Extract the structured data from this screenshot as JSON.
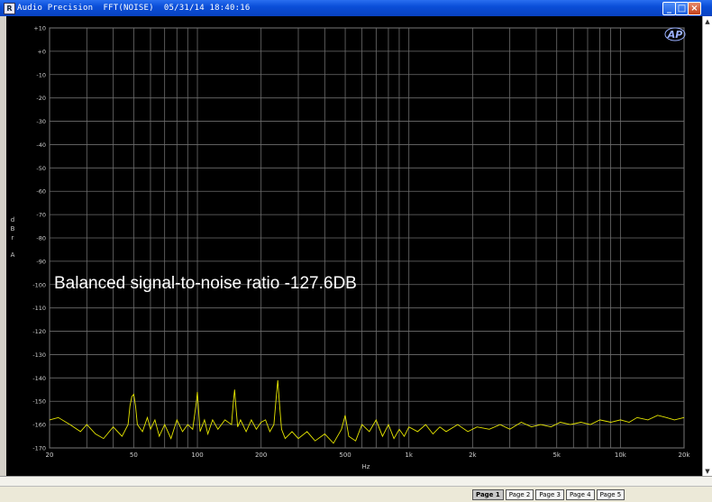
{
  "window": {
    "title": "Audio Precision  FFT(NOISE)  05/31/14 18:40:16",
    "buttons": {
      "minimize": "_",
      "maximize": "□",
      "close": "×"
    }
  },
  "graph": {
    "logo": "AP",
    "annotation": "Balanced signal-to-noise ratio -127.6DB",
    "y_unit_label": [
      "d",
      "B",
      "r",
      "A"
    ]
  },
  "chart_data": {
    "type": "line",
    "xscale": "log",
    "xlabel": "Hz",
    "ylabel": "dBr A",
    "xlim": [
      20,
      20000
    ],
    "ylim": [
      -170,
      10
    ],
    "x_ticks": [
      20,
      50,
      100,
      200,
      500,
      1000,
      2000,
      5000,
      10000,
      20000
    ],
    "x_tick_labels": [
      "20",
      "50",
      "100",
      "200",
      "500",
      "1k",
      "2k",
      "5k",
      "10k",
      "20k"
    ],
    "y_ticks": [
      10,
      0,
      -10,
      -20,
      -30,
      -40,
      -50,
      -60,
      -70,
      -80,
      -90,
      -100,
      -110,
      -120,
      -130,
      -140,
      -150,
      -160,
      -170
    ],
    "y_tick_labels": [
      "+10",
      "+0",
      "-10",
      "-20",
      "-30",
      "-40",
      "-50",
      "-60",
      "-70",
      "-80",
      "-90",
      "-100",
      "-110",
      "-120",
      "-130",
      "-140",
      "-150",
      "-160",
      "-170"
    ],
    "grid": true,
    "trace_color": "#e6e600",
    "series": [
      {
        "x": [
          20,
          22,
          25,
          28,
          30,
          33,
          36,
          40,
          44,
          47,
          48,
          49,
          50,
          51,
          52,
          55,
          58,
          60,
          63,
          66,
          70,
          75,
          80,
          85,
          90,
          95,
          97,
          99,
          100,
          101,
          103,
          108,
          112,
          118,
          125,
          135,
          145,
          148,
          150,
          152,
          155,
          160,
          170,
          180,
          190,
          200,
          210,
          220,
          230,
          235,
          240,
          245,
          250,
          260,
          280,
          300,
          330,
          360,
          400,
          440,
          480,
          500,
          520,
          560,
          600,
          650,
          700,
          750,
          800,
          850,
          900,
          950,
          1000,
          1100,
          1200,
          1300,
          1400,
          1500,
          1700,
          1900,
          2100,
          2400,
          2700,
          3000,
          3400,
          3800,
          4200,
          4700,
          5200,
          5800,
          6500,
          7200,
          8000,
          9000,
          10000,
          11000,
          12000,
          13500,
          15000,
          16500,
          18000,
          20000
        ],
        "y": [
          -158,
          -157,
          -160,
          -163,
          -160,
          -164,
          -166,
          -161,
          -165,
          -160,
          -152,
          -148,
          -147,
          -152,
          -160,
          -163,
          -157,
          -162,
          -158,
          -165,
          -160,
          -166,
          -158,
          -163,
          -160,
          -162,
          -156,
          -150,
          -146,
          -152,
          -163,
          -158,
          -164,
          -158,
          -162,
          -158,
          -160,
          -150,
          -145,
          -152,
          -161,
          -158,
          -163,
          -158,
          -162,
          -159,
          -158,
          -163,
          -160,
          -150,
          -141,
          -152,
          -162,
          -166,
          -163,
          -166,
          -163,
          -167,
          -164,
          -168,
          -162,
          -156,
          -165,
          -167,
          -160,
          -163,
          -158,
          -165,
          -160,
          -166,
          -162,
          -165,
          -161,
          -163,
          -160,
          -164,
          -161,
          -163,
          -160,
          -163,
          -161,
          -162,
          -160,
          -162,
          -159,
          -161,
          -160,
          -161,
          -159,
          -160,
          -159,
          -160,
          -158,
          -159,
          -158,
          -159,
          -157,
          -158,
          -156,
          -157,
          -158,
          -157
        ]
      }
    ]
  }
}
